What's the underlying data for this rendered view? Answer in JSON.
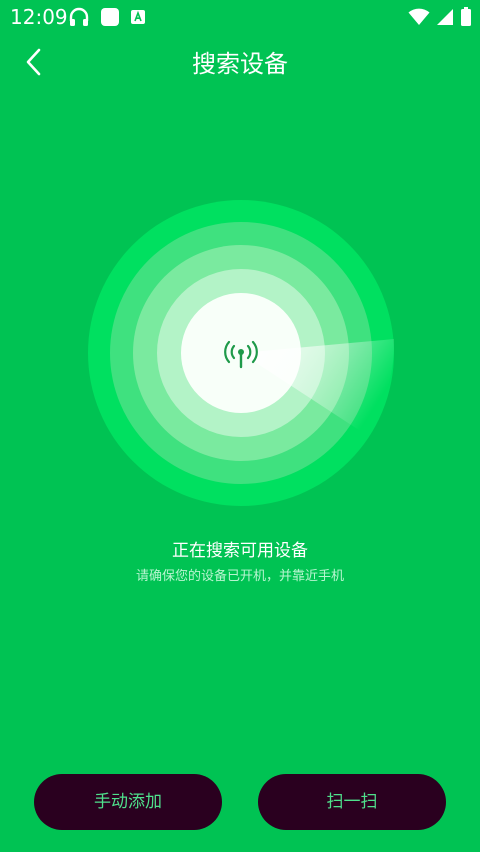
{
  "status_bar": {
    "time": "12:09",
    "left_icons": [
      "headset-icon",
      "app-square-icon",
      "font-a-icon"
    ],
    "right_icons": [
      "wifi-icon",
      "cell-signal-icon",
      "battery-icon"
    ]
  },
  "header": {
    "title": "搜索设备",
    "back_icon": "chevron-left-icon"
  },
  "radar": {
    "center_icon": "antenna-signal-icon"
  },
  "status": {
    "title": "正在搜索可用设备",
    "hint": "请确保您的设备已开机，并靠近手机"
  },
  "actions": {
    "manual_add_label": "手动添加",
    "scan_label": "扫一扫"
  },
  "colors": {
    "background": "#00c353",
    "button_background": "#2a001f",
    "button_text": "#4fe08c",
    "hint_text": "#b7f5d0"
  }
}
